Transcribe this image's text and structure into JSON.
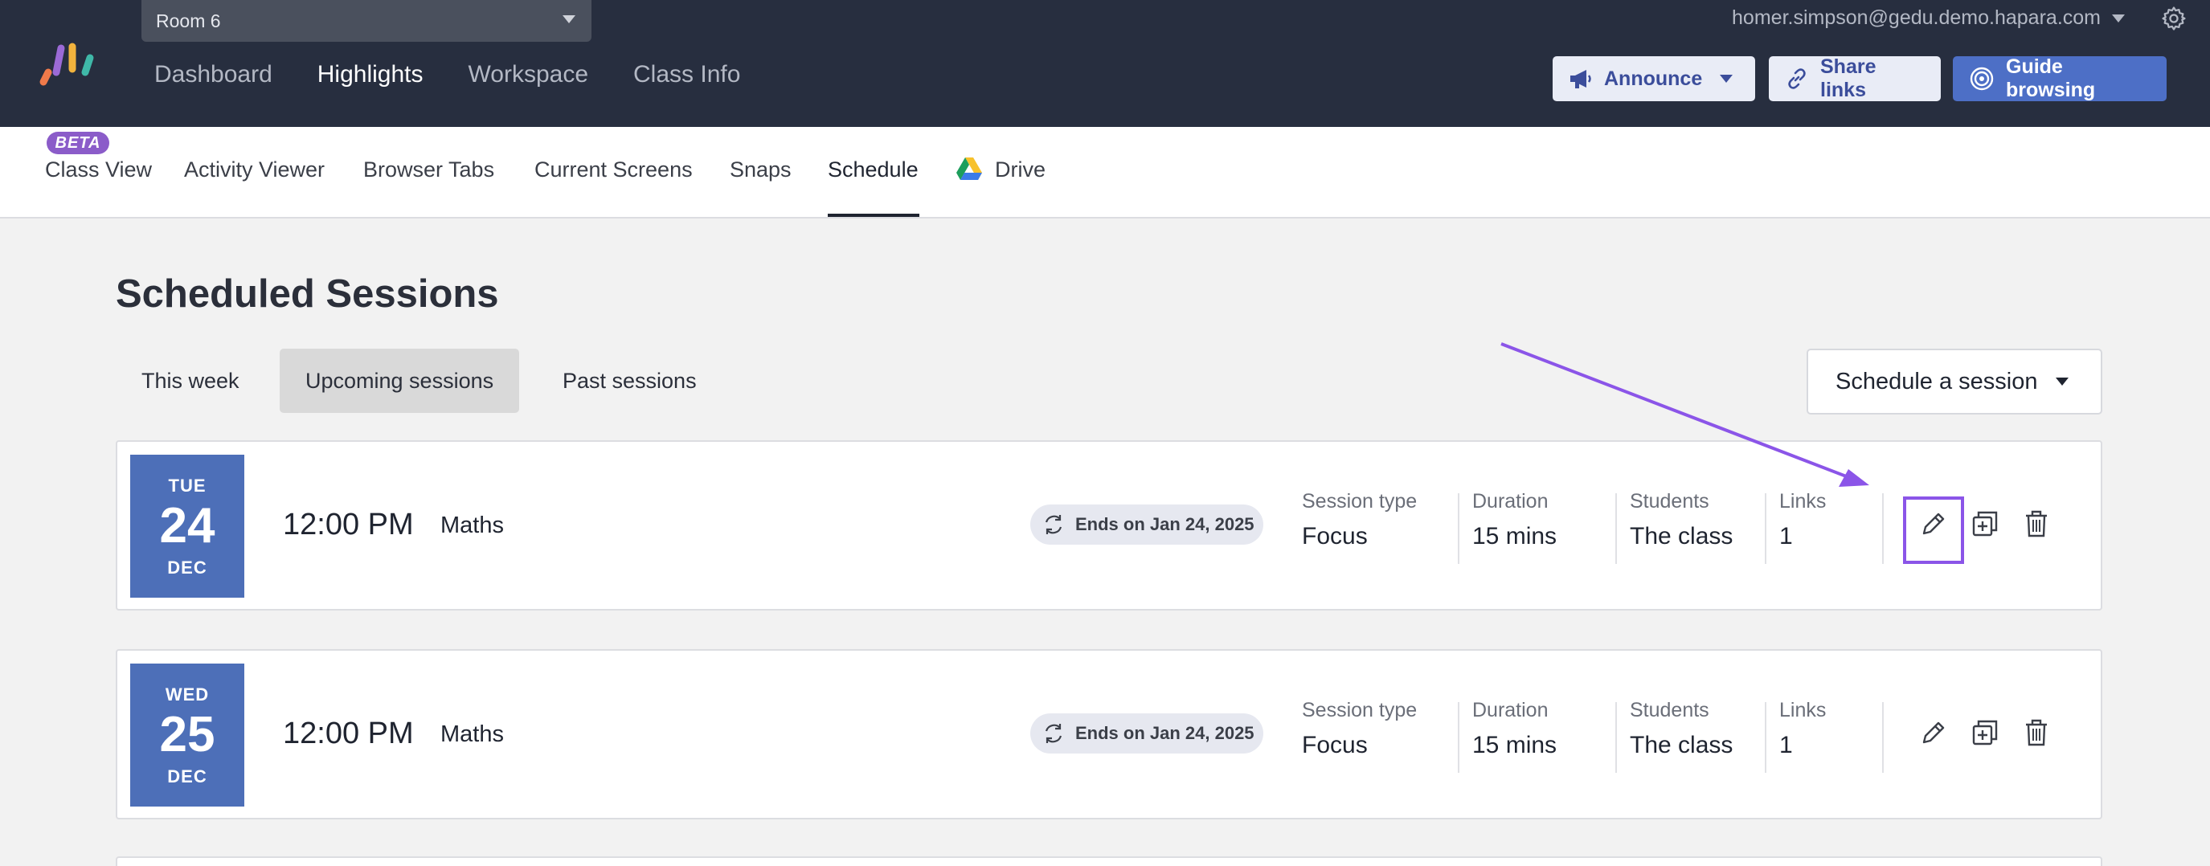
{
  "header": {
    "room": "Room 6",
    "nav": [
      "Dashboard",
      "Highlights",
      "Workspace",
      "Class Info"
    ],
    "active_nav": "Highlights",
    "user_email": "homer.simpson@gedu.demo.hapara.com",
    "buttons": {
      "announce": "Announce",
      "share": "Share links",
      "guide": "Guide browsing"
    }
  },
  "subnav": {
    "beta": "BETA",
    "tabs": [
      "Class View",
      "Activity Viewer",
      "Browser Tabs",
      "Current Screens",
      "Snaps",
      "Schedule",
      "Drive"
    ],
    "active_tab": "Schedule"
  },
  "page": {
    "title": "Scheduled Sessions",
    "filters": [
      "This week",
      "Upcoming sessions",
      "Past sessions"
    ],
    "active_filter": "Upcoming sessions",
    "schedule_button": "Schedule a session"
  },
  "meta_labels": {
    "session_type": "Session type",
    "duration": "Duration",
    "students": "Students",
    "links": "Links"
  },
  "sessions": [
    {
      "dow": "TUE",
      "day": "24",
      "month": "DEC",
      "time": "12:00 PM",
      "subject": "Maths",
      "ends": "Ends on Jan 24, 2025",
      "session_type": "Focus",
      "duration": "15 mins",
      "students": "The class",
      "links": "1"
    },
    {
      "dow": "WED",
      "day": "25",
      "month": "DEC",
      "time": "12:00 PM",
      "subject": "Maths",
      "ends": "Ends on Jan 24, 2025",
      "session_type": "Focus",
      "duration": "15 mins",
      "students": "The class",
      "links": "1"
    }
  ],
  "colors": {
    "header_bg": "#272e3f",
    "accent": "#4d6fc6",
    "date_block": "#4d6fb8",
    "highlight": "#8b55e8",
    "beta": "#8b5cc9"
  },
  "icons": [
    "hapara-logo-icon",
    "chevron-down-icon",
    "gear-icon",
    "megaphone-icon",
    "link-icon",
    "target-icon",
    "google-drive-icon",
    "recurring-icon",
    "pencil-icon",
    "duplicate-icon",
    "trash-icon"
  ]
}
